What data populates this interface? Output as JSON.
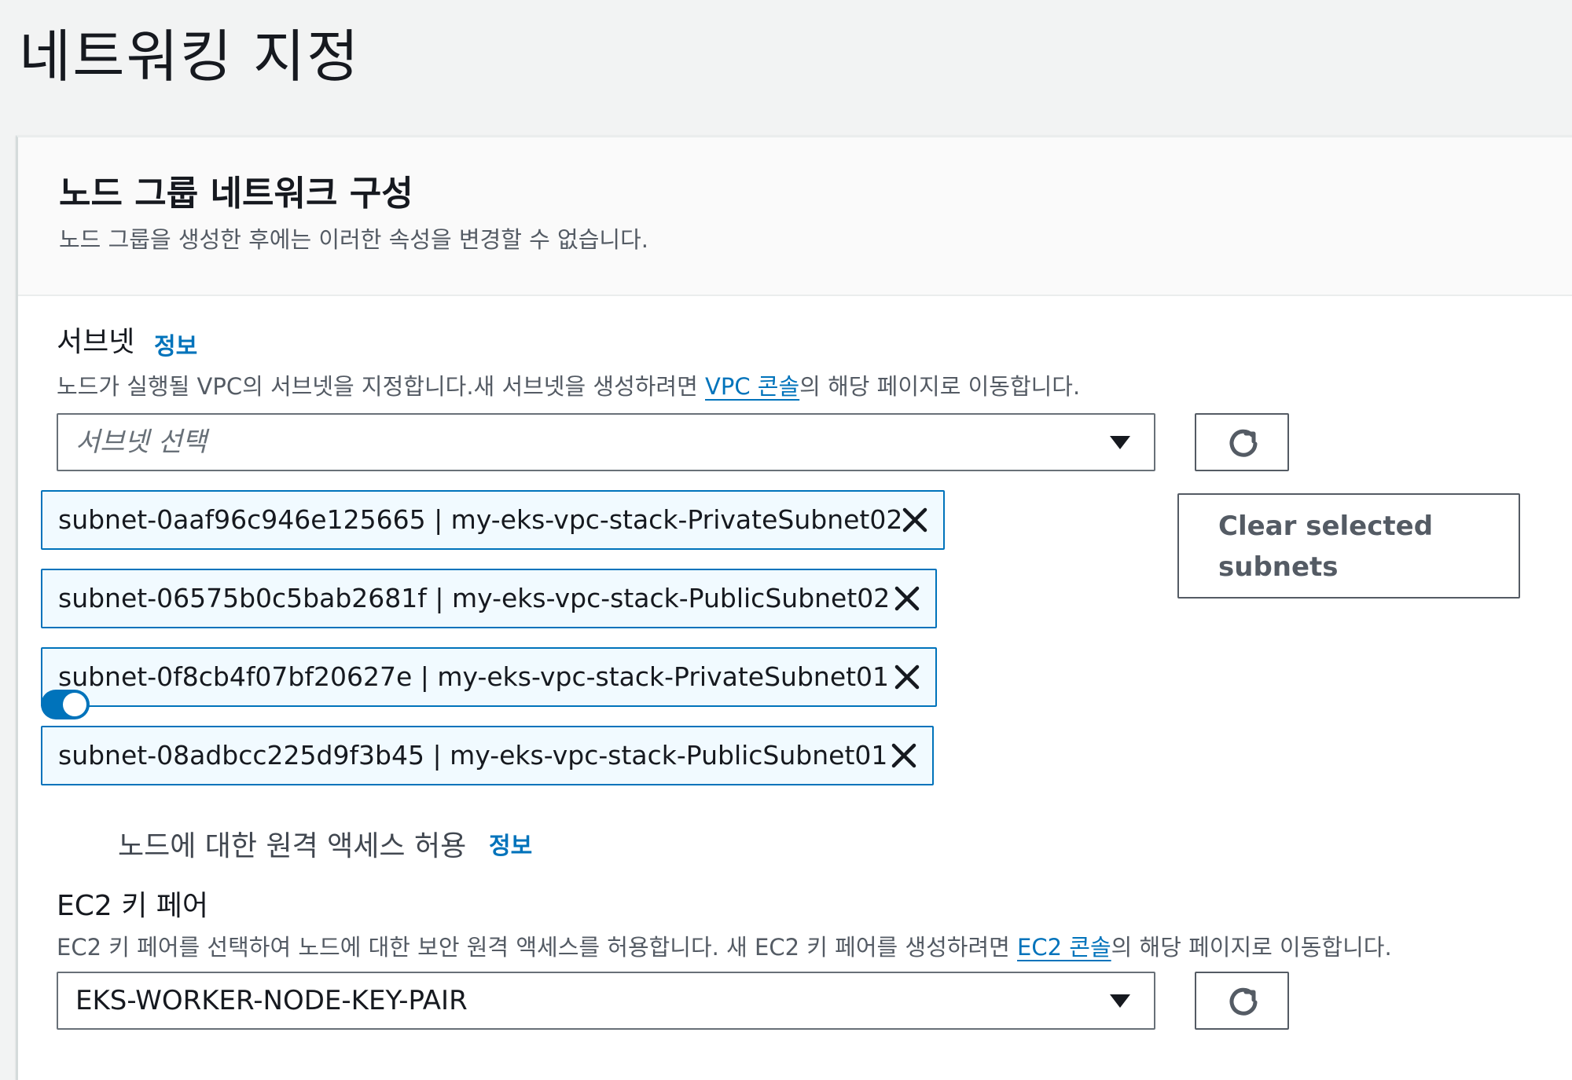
{
  "page": {
    "title": "네트워킹 지정"
  },
  "panel": {
    "title": "노드 그룹 네트워크 구성",
    "description": "노드 그룹을 생성한 후에는 이러한 속성을 변경할 수 없습니다."
  },
  "subnets": {
    "label": "서브넷",
    "info_link": "정보",
    "description_prefix": "노드가 실행될 VPC의 서브넷을 지정합니다.새 서브넷을 생성하려면 ",
    "description_link": "VPC 콘솔",
    "description_suffix": "의 해당 페이지로 이동합니다.",
    "select_placeholder": "서브넷 선택",
    "selected": [
      {
        "label": "subnet-0aaf96c946e125665 | my-eks-vpc-stack-PrivateSubnet02"
      },
      {
        "label": "subnet-06575b0c5bab2681f | my-eks-vpc-stack-PublicSubnet02"
      },
      {
        "label": "subnet-0f8cb4f07bf20627e | my-eks-vpc-stack-PrivateSubnet01"
      },
      {
        "label": "subnet-08adbcc225d9f3b45 | my-eks-vpc-stack-PublicSubnet01"
      }
    ],
    "clear_button_label": "Clear selected subnets"
  },
  "remote_access": {
    "label": "노드에 대한 원격 액세스 허용",
    "info_link": "정보",
    "enabled": true
  },
  "key_pair": {
    "label": "EC2 키 페어",
    "description_prefix": "EC2 키 페어를 선택하여 노드에 대한 보안 원격 액세스를 허용합니다. 새 EC2 키 페어를 생성하려면 ",
    "description_link": "EC2 콘솔",
    "description_suffix": "의 해당 페이지로 이동합니다.",
    "selected_value": "EKS-WORKER-NODE-KEY-PAIR"
  },
  "icons": {
    "refresh": "refresh-icon",
    "remove": "close-icon",
    "dropdown": "caret-down-icon"
  },
  "colors": {
    "accent": "#0073bb",
    "token_background": "#f1faff",
    "page_background": "#f2f3f3"
  }
}
